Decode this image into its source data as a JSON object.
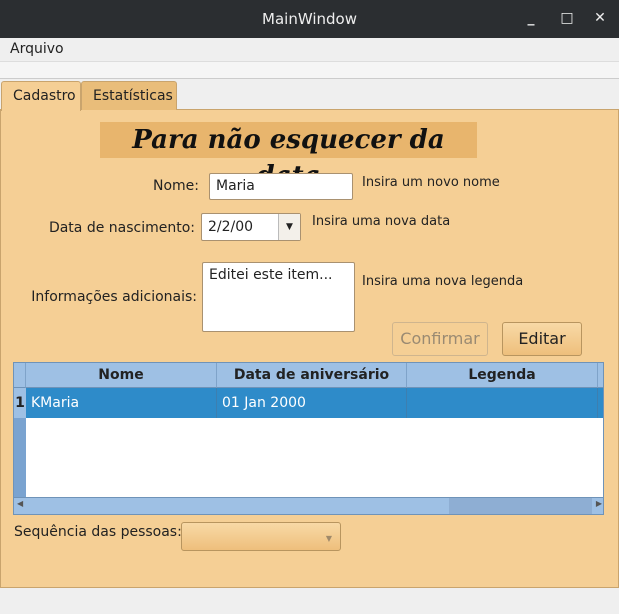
{
  "window": {
    "title": "MainWindow",
    "minimize": "_",
    "maximize": "□",
    "close": "✕"
  },
  "menu": {
    "file": "Arquivo"
  },
  "tabs": [
    {
      "label": "Cadastro",
      "active": true
    },
    {
      "label": "Estatísticas",
      "active": false
    }
  ],
  "form": {
    "heading": "Para não esquecer da data",
    "name_label": "Nome:",
    "name_value": "Maria",
    "name_hint": "Insira um novo nome",
    "date_label": "Data de nascimento:",
    "date_value": "2/2/00",
    "date_hint": "Insira uma nova data",
    "info_label": "Informações adicionais:",
    "info_value": "Editei este item...",
    "info_hint": "Insira uma nova legenda",
    "confirm_label": "Confirmar",
    "edit_label": "Editar"
  },
  "table": {
    "columns": [
      "Nome",
      "Data de aniversário",
      "Legenda"
    ],
    "rows": [
      {
        "index": "1",
        "nome": "KMaria",
        "data": "01 Jan 2000",
        "legenda": ""
      }
    ],
    "selected_color": "#2e8bc9"
  },
  "sequence": {
    "label": "Sequência das pessoas:",
    "value": ""
  }
}
